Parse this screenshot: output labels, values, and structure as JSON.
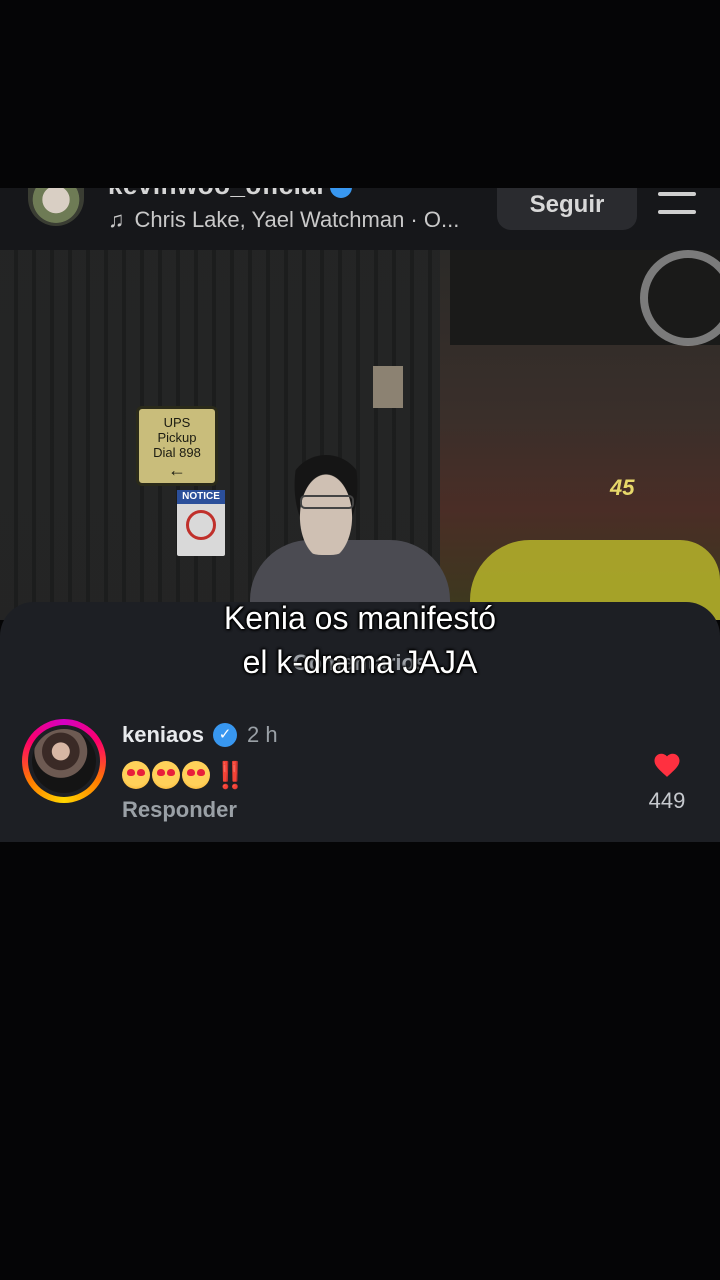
{
  "header": {
    "username": "kevinwoo_oficial",
    "music": "Chris Lake, Yael Watchman · O...",
    "follow_label": "Seguir"
  },
  "photo": {
    "ups_sign": [
      "UPS",
      "Pickup",
      "Dial 898"
    ],
    "notice_label": "NOTICE",
    "door_tag": "45"
  },
  "sheet": {
    "title": "Comentarios"
  },
  "caption": {
    "line1": "Kenia os manifestó",
    "line2": "el k-drama JAJA"
  },
  "comment": {
    "username": "keniaos",
    "time": "2 h",
    "emoji_count": 3,
    "punctuation": "‼️",
    "reply_label": "Responder",
    "likes": "449",
    "like_color": "#ff3040"
  }
}
